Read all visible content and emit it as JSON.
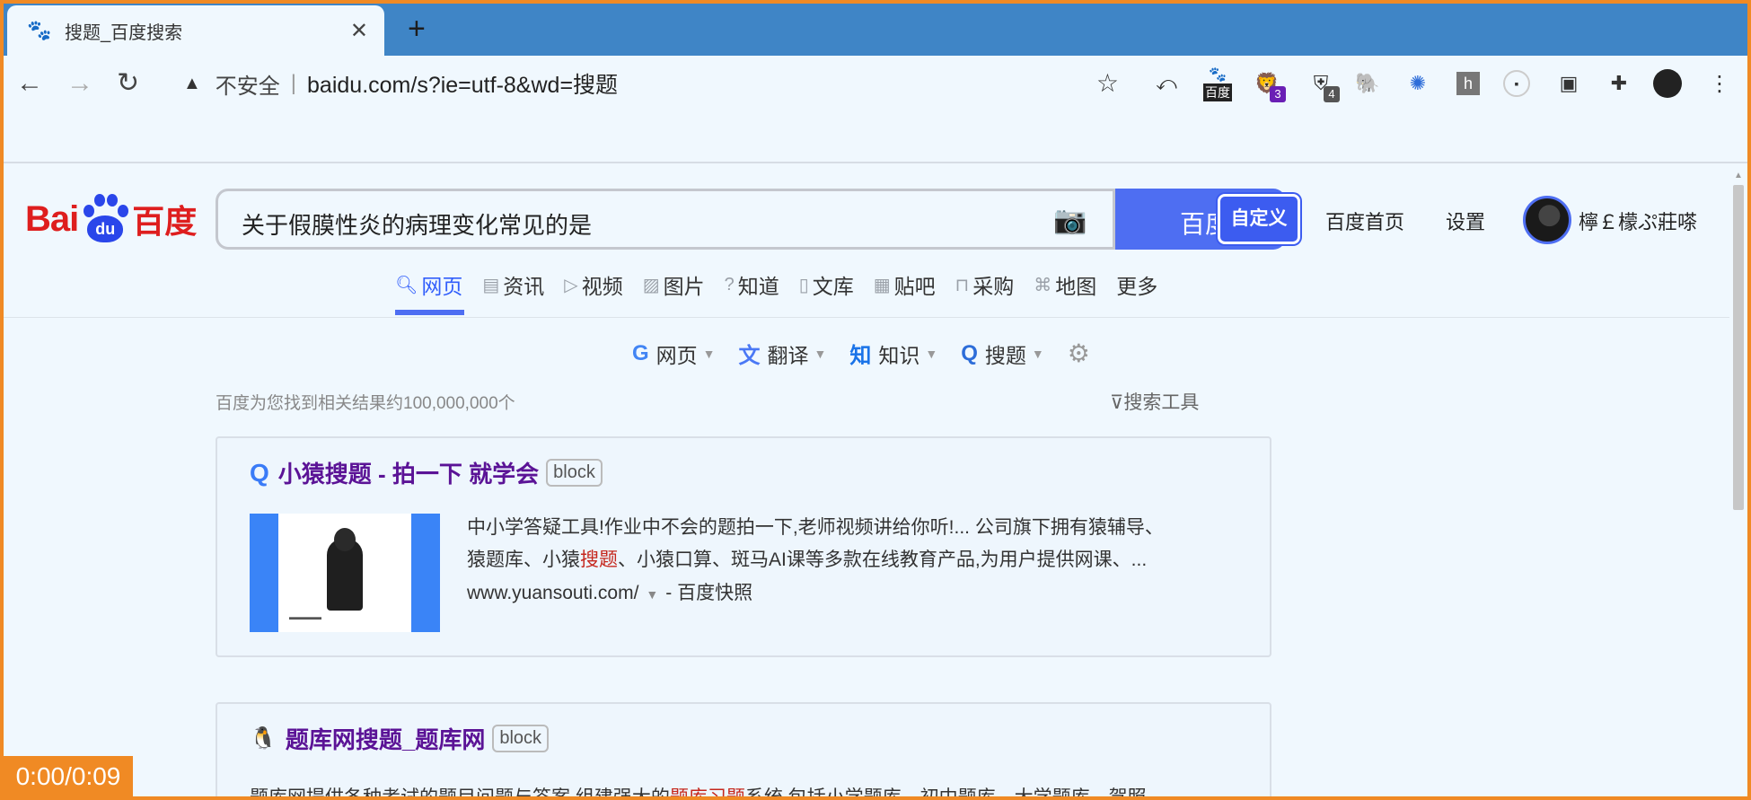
{
  "browser": {
    "tab_title": "搜题_百度搜索",
    "tab_close": "✕",
    "new_tab": "+",
    "back": "←",
    "forward": "→",
    "reload": "↻",
    "insecure_label": "不安全",
    "separator": "|",
    "url": "baidu.com/s?ie=utf-8&wd=搜题",
    "extensions": [
      {
        "name": "baidu",
        "label": "百度"
      },
      {
        "name": "lion",
        "badge": "3",
        "badge_color": "#6a1fb5"
      },
      {
        "name": "shield",
        "badge": "4",
        "badge_color": "#555555"
      },
      {
        "name": "h",
        "label": "h"
      }
    ]
  },
  "baidu": {
    "logo_left": "Bai",
    "logo_paw": "du",
    "logo_cn": "百度",
    "query": "关于假膜性炎的病理变化常见的是",
    "search_button": "百度一",
    "custom_button": "自定义",
    "home_link": "百度首页",
    "settings_link": "设置",
    "user_name": "檸￡檬ぷ莊嗏",
    "nav_tabs": [
      {
        "label": "网页",
        "icon": "search-icon",
        "active": true
      },
      {
        "label": "资讯",
        "icon": "news-icon"
      },
      {
        "label": "视频",
        "icon": "video-icon"
      },
      {
        "label": "图片",
        "icon": "image-icon"
      },
      {
        "label": "知道",
        "icon": "question-icon"
      },
      {
        "label": "文库",
        "icon": "doc-icon"
      },
      {
        "label": "贴吧",
        "icon": "tieba-icon"
      },
      {
        "label": "采购",
        "icon": "basket-icon"
      },
      {
        "label": "地图",
        "icon": "map-icon"
      },
      {
        "label": "更多"
      }
    ],
    "tools": [
      {
        "icon": "G",
        "label": "网页"
      },
      {
        "icon": "文",
        "label": "翻译"
      },
      {
        "icon": "知",
        "label": "知识"
      },
      {
        "icon": "Q",
        "label": "搜题"
      }
    ],
    "result_count": "百度为您找到相关结果约100,000,000个",
    "search_tools": "搜索工具"
  },
  "results": [
    {
      "title": "小猿搜题 - 拍一下 就学会",
      "tag": "block",
      "snippet_1": "中小学答疑工具!作业中不会的题拍一下,老师视频讲给你听!... 公司旗下拥有猿辅导、",
      "snippet_2a": "猿题库、小猿",
      "snippet_2_hl": "搜题",
      "snippet_2b": "、小猿口算、斑马AI课等多款在线教育产品,为用户提供网课、...",
      "url": "www.yuansouti.com/",
      "snapshot": "- 百度快照"
    },
    {
      "title": "题库网搜题_题库网",
      "tag": "block",
      "snippet_a": "题库网提供各种考试的题目问题与答案,组建强大的",
      "snippet_hl": "题库习题",
      "snippet_b": "系统,包括小学题库、初中题库、大学题库、驾照"
    }
  ],
  "timer": "0:00/0:09"
}
